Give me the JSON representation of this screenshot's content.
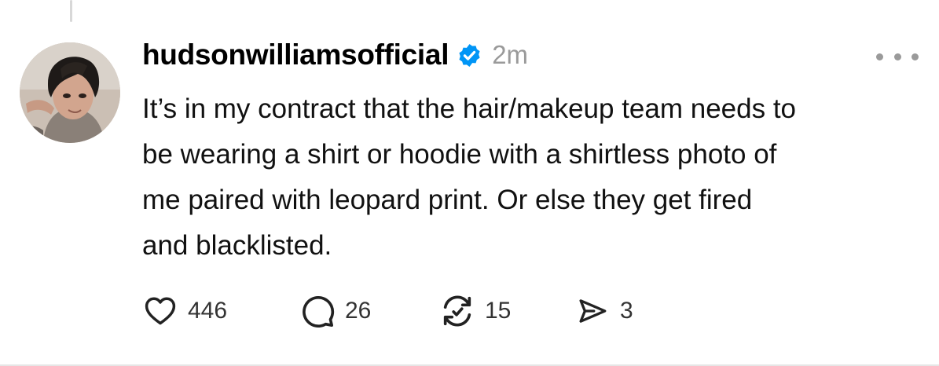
{
  "post": {
    "username": "hudsonwilliamsofficial",
    "verified": true,
    "timestamp": "2m",
    "text_lines": [
      "It’s in my contract that the hair/makeup team needs to",
      "be wearing a shirt or hoodie with a shirtless photo of",
      "me paired with leopard print. Or else they get fired",
      "and blacklisted."
    ],
    "actions": {
      "likes": "446",
      "replies": "26",
      "reposts": "15",
      "shares": "3"
    }
  },
  "icons": {
    "verified": "verified-badge-icon",
    "more": "more-options-icon",
    "like": "heart-icon",
    "reply": "speech-bubble-icon",
    "repost": "repost-icon",
    "share": "send-icon"
  },
  "colors": {
    "verified_blue": "#0095f6",
    "secondary_text": "#9a9a9a",
    "primary_text": "#111111"
  }
}
